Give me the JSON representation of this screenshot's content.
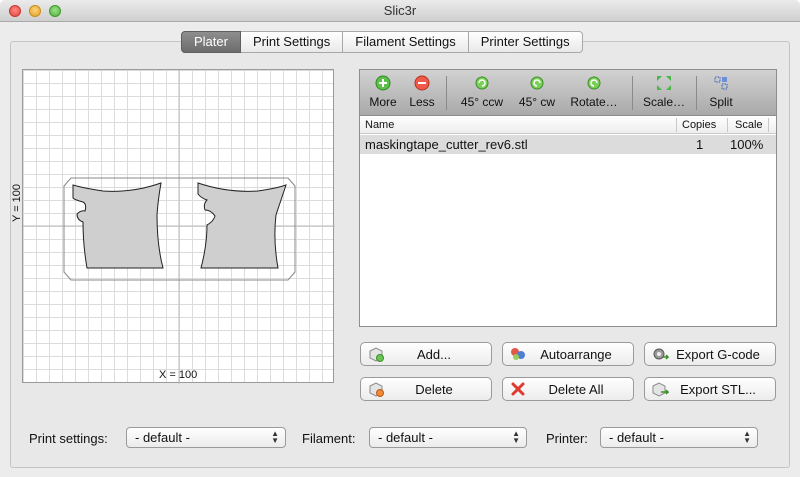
{
  "window": {
    "title": "Slic3r"
  },
  "tabs": [
    "Plater",
    "Print Settings",
    "Filament Settings",
    "Printer Settings"
  ],
  "plater": {
    "x_label": "X = 100",
    "y_label": "Y = 100"
  },
  "toolbar": {
    "more": "More",
    "less": "Less",
    "rot_ccw": "45° ccw",
    "rot_cw": "45° cw",
    "rotate": "Rotate…",
    "scale": "Scale…",
    "split": "Split"
  },
  "object_list": {
    "headers": {
      "name": "Name",
      "copies": "Copies",
      "scale": "Scale"
    },
    "rows": [
      {
        "name": "maskingtape_cutter_rev6.stl",
        "copies": "1",
        "scale": "100%"
      }
    ]
  },
  "buttons": {
    "add": "Add...",
    "autoarrange": "Autoarrange",
    "export_gcode": "Export G-code",
    "delete": "Delete",
    "delete_all": "Delete All",
    "export_stl": "Export STL..."
  },
  "bottom": {
    "print_label": "Print settings:",
    "print_value": "- default -",
    "filament_label": "Filament:",
    "filament_value": "- default -",
    "printer_label": "Printer:",
    "printer_value": "- default -"
  }
}
